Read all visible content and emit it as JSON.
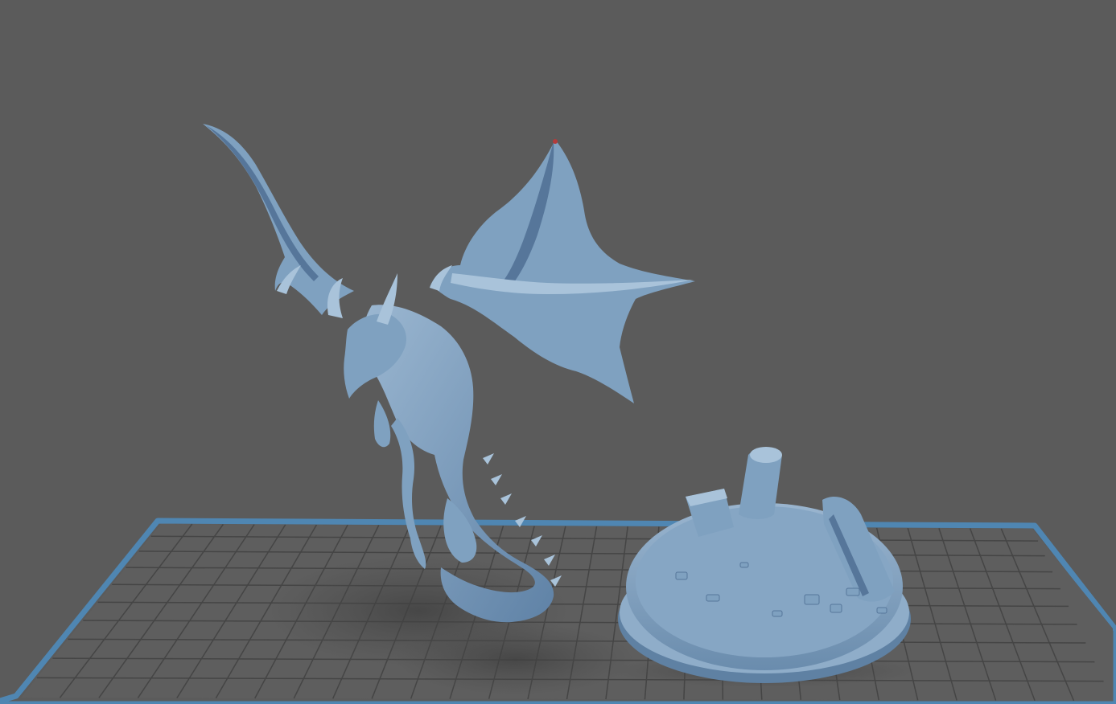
{
  "viewport": {
    "background_color": "#5b5b5b"
  },
  "build_plate": {
    "frame_color": "#4f86b2",
    "surface_color": "#5e5e5e",
    "grid_line_color": "#454545",
    "grid_columns": 28,
    "grid_rows": 10
  },
  "models": {
    "fill_color": "#7fa1c0",
    "highlight_color": "#a9c3da",
    "shadow_color": "#56769a",
    "items": [
      {
        "icon": "dragon-model"
      },
      {
        "icon": "round-scenic-base-model"
      }
    ]
  }
}
